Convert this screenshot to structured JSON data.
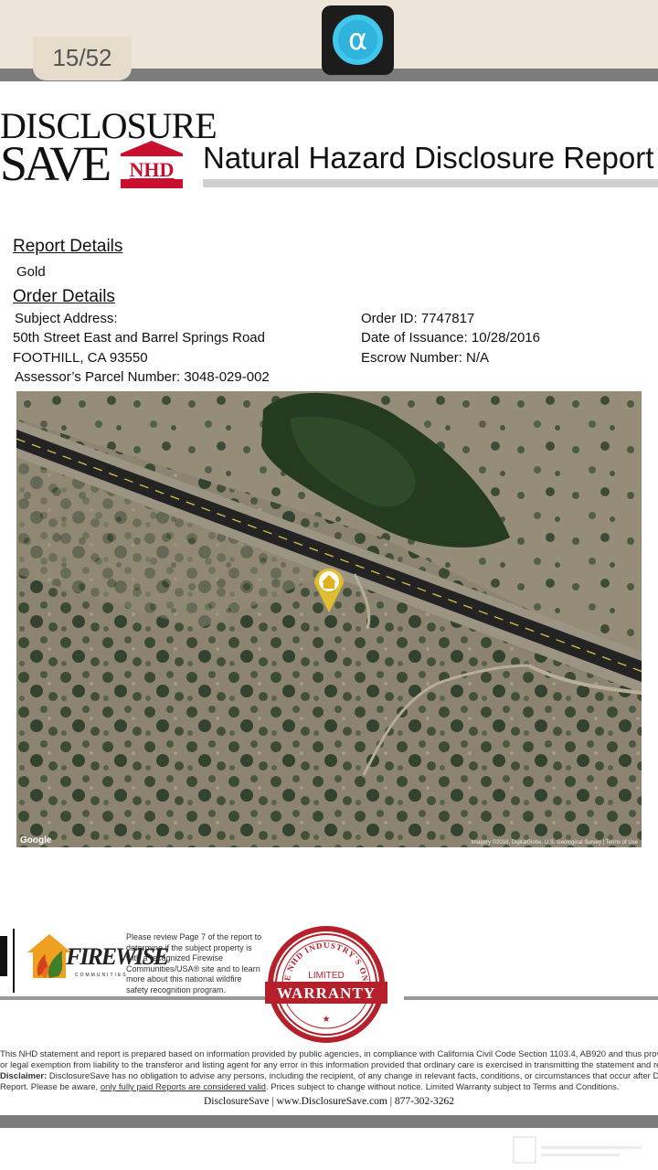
{
  "viewer": {
    "page_counter": "15/52",
    "app_icon_glyph": "α",
    "app_icon": "alpha-app-icon"
  },
  "header": {
    "brand_line1": "DISCLOSURE",
    "brand_line2": "SAVE",
    "brand_badge": "NHD",
    "report_title": "Natural Hazard Disclosure Report"
  },
  "report_details": {
    "heading": "Report Details",
    "level": "Gold"
  },
  "order_details": {
    "heading": "Order Details",
    "subject_address_label": "Subject Address:",
    "address_line1": "50th Street East and Barrel Springs Road",
    "address_line2": "FOOTHILL, CA 93550",
    "apn_label": "Assessor’s Parcel Number:",
    "apn_value": "3048-029-002",
    "order_id_label": "Order ID:",
    "order_id": "7747817",
    "issuance_label": "Date of Issuance:",
    "issuance_date": "10/28/2016",
    "escrow_label": "Escrow Number:",
    "escrow_number": "N/A"
  },
  "map": {
    "google_label": "Google",
    "attribution": "Imagery ©2016, DigitalGlobe, U.S. Geological Survey | Terms of Use",
    "marker_icon": "home-marker-icon"
  },
  "footer": {
    "firewise_name": "FIREWISE",
    "firewise_sub": "COMMUNITIES",
    "firewise_note": "Please review Page 7 of the report to determine if the subject property is with a recognized Firewise Communities/USA® site and to learn more about this national wildfire safety recognition program.",
    "warranty_arc": "THE NHD INDUSTRY'S ONLY",
    "warranty_top": "LIMITED",
    "warranty_main": "WARRANTY",
    "legal_line1": "This NHD statement and report is prepared based on information provided by public agencies, in compliance with California Civil Code Section 1103.4, AB920 and thus provides",
    "legal_line2": "or legal exemption from liability to the transferor and listing agent for any error in this information provided that ordinary care is exercised in transmitting the statement and report",
    "legal_line3_bold": "Disclaimer:",
    "legal_line3": " DisclosureSave has no obligation to advise any persons, including the recipient, of any change in relevant facts, conditions, or circumstances that occur after Date of",
    "legal_line4_a": "Report. Please be aware, ",
    "legal_line4_u": "only fully paid Reports are considered valid",
    "legal_line4_b": ". Prices subject to change without notice.  Limited Warranty subject to Terms and Conditions.",
    "contact": "DisclosureSave | www.DisclosureSave.com | 877-302-3262"
  },
  "colors": {
    "brand_red": "#c8102e",
    "warranty_red": "#b5202b",
    "chrome_beige": "#ece5d8",
    "app_icon_blue": "#42c7ec"
  }
}
